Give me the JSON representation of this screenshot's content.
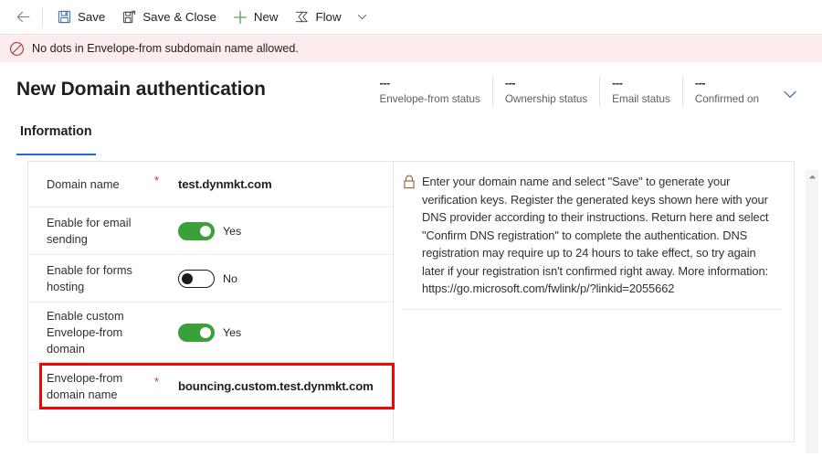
{
  "commandbar": {
    "back_label": "Back",
    "items": [
      {
        "label": "Save",
        "icon": "save-icon"
      },
      {
        "label": "Save & Close",
        "icon": "save-and-close-icon"
      },
      {
        "label": "New",
        "icon": "plus-icon"
      },
      {
        "label": "Flow",
        "icon": "flow-icon"
      }
    ],
    "overflow_label": "More commands"
  },
  "notification": {
    "icon": "blocked-icon",
    "message": "No dots in Envelope-from subdomain name allowed."
  },
  "header": {
    "title": "New Domain authentication",
    "stats": [
      {
        "value": "---",
        "label": "Envelope-from status"
      },
      {
        "value": "---",
        "label": "Ownership status"
      },
      {
        "value": "---",
        "label": "Email status"
      },
      {
        "value": "---",
        "label": "Confirmed on"
      }
    ],
    "expand_icon": "chevron-down-icon"
  },
  "tabs": [
    {
      "label": "Information",
      "active": true
    }
  ],
  "form": {
    "required_marker": "*",
    "fields": [
      {
        "label": "Domain name",
        "required": true,
        "type": "text",
        "value": "test.dynmkt.com"
      },
      {
        "label": "Enable for email sending",
        "required": false,
        "type": "toggle",
        "state": "on",
        "value": "Yes"
      },
      {
        "label": "Enable for forms hosting",
        "required": false,
        "type": "toggle",
        "state": "off",
        "value": "No"
      },
      {
        "label": "Enable custom Envelope-from domain",
        "required": false,
        "type": "toggle",
        "state": "on",
        "value": "Yes"
      },
      {
        "label": "Envelope-from domain name",
        "required": true,
        "type": "text",
        "value": "bouncing.custom.test.dynmkt.com",
        "highlighted": true
      }
    ]
  },
  "info": {
    "icon": "lock-icon",
    "text": "Enter your domain name and select \"Save\" to generate your verification keys. Register the generated keys shown here with your DNS provider according to their instructions. Return here and select \"Confirm DNS registration\" to complete the authentication. DNS registration may require up to 24 hours to take effect, so try again later if your registration isn't confirmed right away. More information: https://go.microsoft.com/fwlink/p/?linkid=2055662"
  },
  "scrollbar": {
    "up_arrow": "scroll-up-arrow"
  },
  "colors": {
    "accent": "#2266dd",
    "toggle_on": "#3aa03a",
    "error_bg": "#fdeced",
    "error_fg": "#a4373a",
    "highlight": "#ff0000",
    "required": "#d13438"
  }
}
